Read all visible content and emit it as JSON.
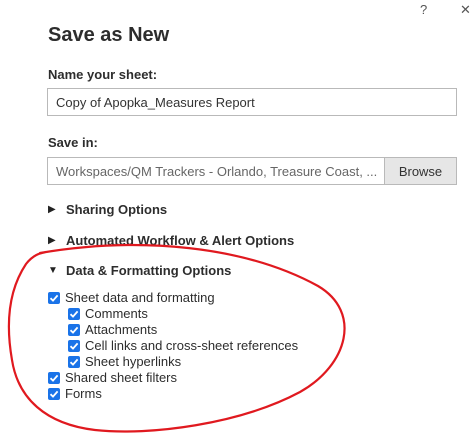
{
  "dialog": {
    "title": "Save as New",
    "help_glyph": "?",
    "close_glyph": "✕"
  },
  "name": {
    "label": "Name your sheet:",
    "value": "Copy of Apopka_Measures Report"
  },
  "save_in": {
    "label": "Save in:",
    "path": "Workspaces/QM Trackers - Orlando, Treasure Coast, ...",
    "browse_label": "Browse"
  },
  "sections": [
    {
      "label": "Sharing Options",
      "expanded": false
    },
    {
      "label": "Automated Workflow & Alert Options",
      "expanded": false
    },
    {
      "label": "Data & Formatting Options",
      "expanded": true
    }
  ],
  "options": {
    "sheet_data": {
      "label": "Sheet data and formatting",
      "checked": true
    },
    "comments": {
      "label": "Comments",
      "checked": true
    },
    "attachments": {
      "label": "Attachments",
      "checked": true
    },
    "cell_links": {
      "label": "Cell links and cross-sheet references",
      "checked": true
    },
    "hyperlinks": {
      "label": "Sheet hyperlinks",
      "checked": true
    },
    "filters": {
      "label": "Shared sheet filters",
      "checked": true
    },
    "forms": {
      "label": "Forms",
      "checked": true
    }
  },
  "colors": {
    "checkbox": "#1a73e8",
    "annotation": "#e0191f"
  }
}
